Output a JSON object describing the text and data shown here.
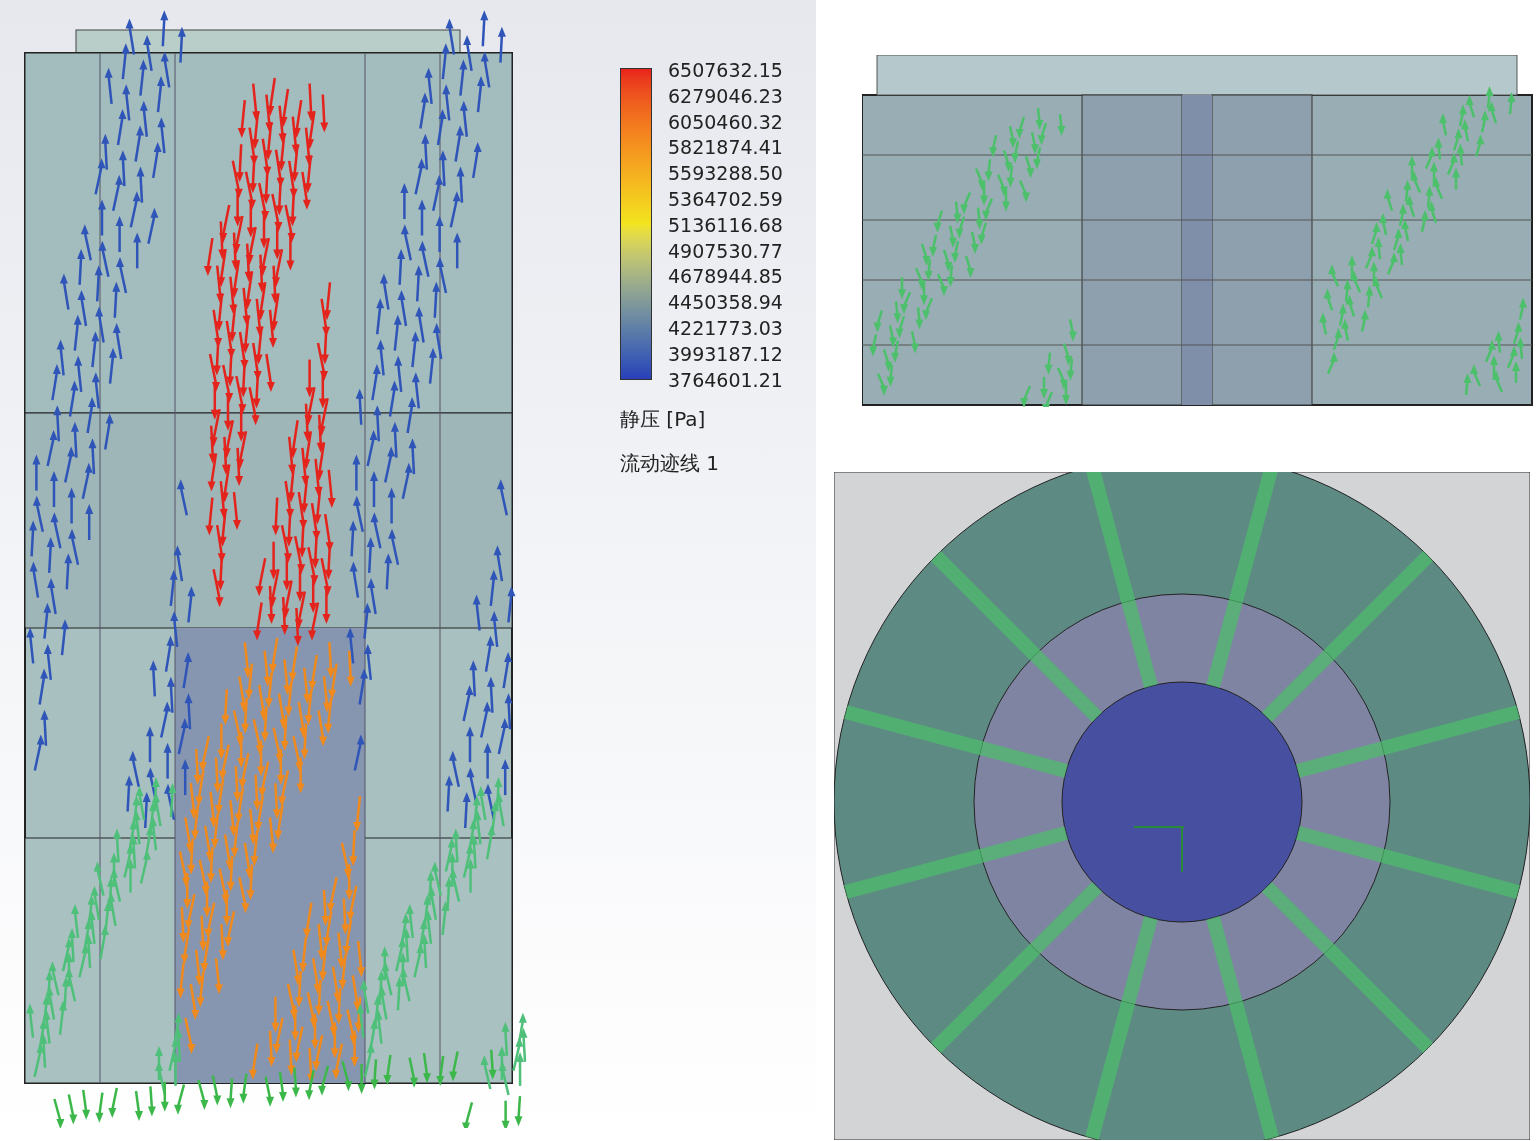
{
  "legend": {
    "values": [
      "6507632.15",
      "6279046.23",
      "6050460.32",
      "5821874.41",
      "5593288.50",
      "5364702.59",
      "5136116.68",
      "4907530.77",
      "4678944.85",
      "4450358.94",
      "4221773.03",
      "3993187.12",
      "3764601.21"
    ],
    "quantity": "静压 [Pa]",
    "trajectory": "流动迹线 1"
  }
}
